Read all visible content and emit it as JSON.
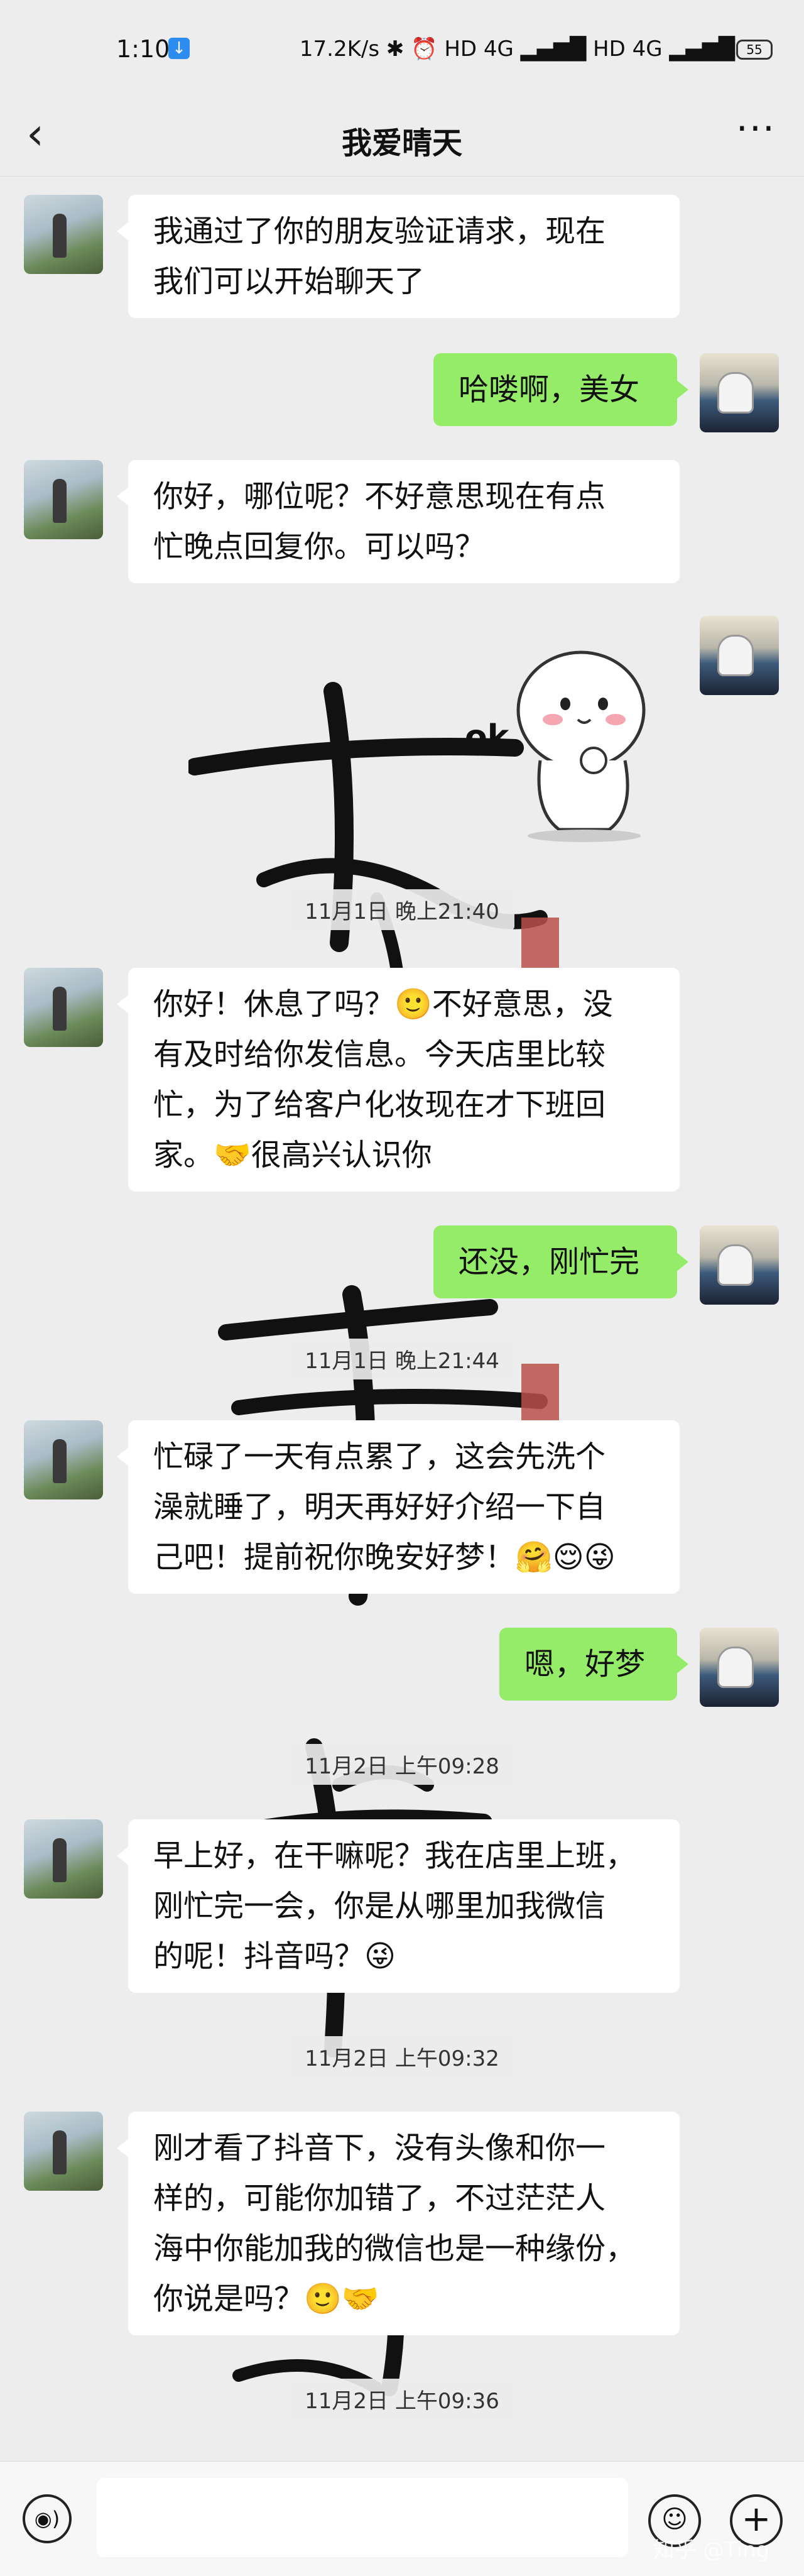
{
  "status_bar": {
    "time": "1:10",
    "right": "17.2K/s ✱ ⏰ HD 4G ▂▄▆█ HD 4G ▂▄▆█",
    "battery": "55"
  },
  "nav": {
    "title": "我爱晴天"
  },
  "messages": [
    {
      "side": "in",
      "lines": [
        "我通过了你的朋友验证请求，现在",
        "我们可以开始聊天了"
      ]
    },
    {
      "side": "out",
      "lines": [
        "哈喽啊，美女"
      ]
    },
    {
      "side": "in",
      "lines": [
        "你好，哪位呢？不好意思现在有点",
        "忙晚点回复你。可以吗？"
      ]
    },
    {
      "side": "out-sticker",
      "sticker_text": "ok"
    },
    {
      "timestamp": "11月1日 晚上21:40"
    },
    {
      "side": "in",
      "lines": [
        "你好！休息了吗？🙂不好意思，没",
        "有及时给你发信息。今天店里比较",
        "忙，为了给客户化妆现在才下班回",
        "家。🤝很高兴认识你"
      ]
    },
    {
      "side": "out",
      "lines": [
        "还没，刚忙完"
      ]
    },
    {
      "timestamp": "11月1日 晚上21:44"
    },
    {
      "side": "in",
      "lines": [
        "忙碌了一天有点累了，这会先洗个",
        "澡就睡了，明天再好好介绍一下自",
        "己吧！提前祝你晚安好梦！🤗😌😜"
      ]
    },
    {
      "side": "out",
      "lines": [
        "嗯，好梦"
      ]
    },
    {
      "timestamp": "11月2日 上午09:28"
    },
    {
      "side": "in",
      "lines": [
        "早上好，在干嘛呢？我在店里上班，",
        "刚忙完一会，你是从哪里加我微信",
        "的呢！抖音吗？😜"
      ]
    },
    {
      "timestamp": "11月2日 上午09:32"
    },
    {
      "side": "in",
      "lines": [
        "刚才看了抖音下，没有头像和你一",
        "样的，可能你加错了，不过茫茫人",
        "海中你能加我的微信也是一种缘份，",
        "你说是吗？🙂🤝"
      ]
    },
    {
      "timestamp": "11月2日 上午09:36"
    }
  ],
  "input": {
    "value": ""
  },
  "watermark": "知乎 @Ting",
  "colors": {
    "out_bubble": "#95ec69",
    "in_bubble": "#ffffff",
    "background": "#ededed"
  }
}
